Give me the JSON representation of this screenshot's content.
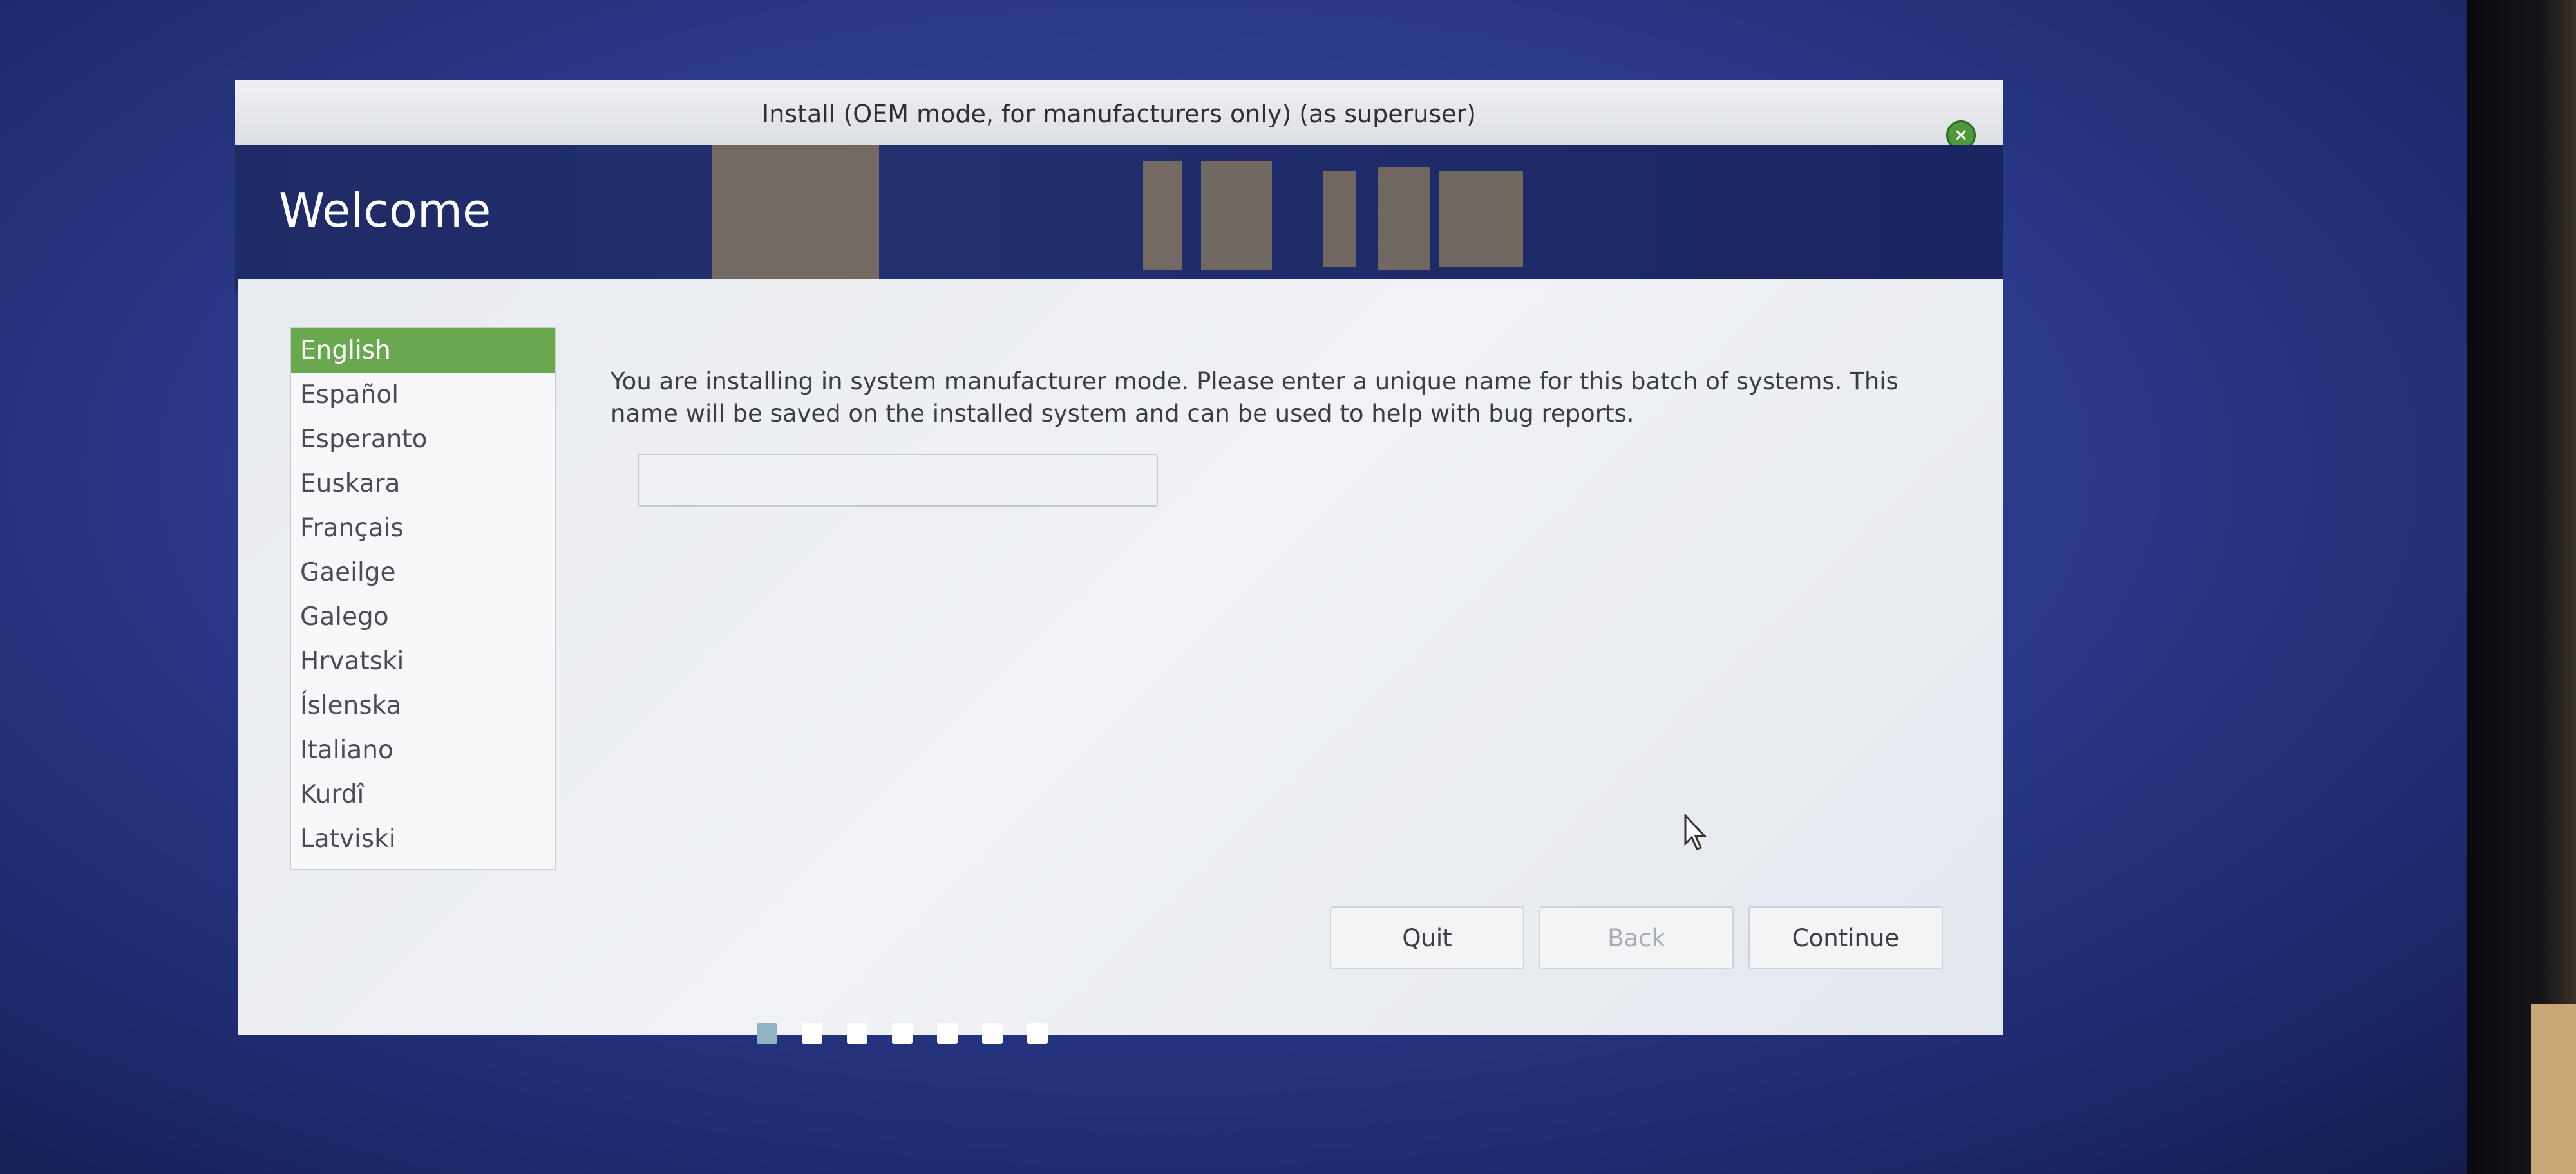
{
  "window": {
    "title": "Install (OEM mode, for manufacturers only) (as superuser)",
    "close_icon": "close-icon"
  },
  "banner": {
    "heading": "Welcome"
  },
  "languages": [
    {
      "label": "English",
      "selected": true
    },
    {
      "label": "Español"
    },
    {
      "label": "Esperanto"
    },
    {
      "label": "Euskara"
    },
    {
      "label": "Français"
    },
    {
      "label": "Gaeilge"
    },
    {
      "label": "Galego"
    },
    {
      "label": "Hrvatski"
    },
    {
      "label": "Íslenska"
    },
    {
      "label": "Italiano"
    },
    {
      "label": "Kurdî"
    },
    {
      "label": "Latviski"
    }
  ],
  "main": {
    "message": "You are installing in system manufacturer mode. Please enter a unique name for this batch of systems. This name will be saved on the installed system and can be used to help with bug reports.",
    "batch_name_value": ""
  },
  "buttons": {
    "quit": "Quit",
    "back": "Back",
    "continue": "Continue"
  },
  "progress": {
    "total_steps": 7,
    "current_step": 1
  },
  "colors": {
    "selection": "#6aa84f",
    "banner": "#1f2b66",
    "close": "#4e9a3a"
  }
}
